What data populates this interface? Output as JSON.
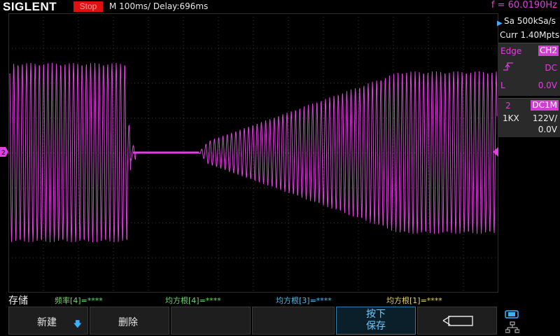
{
  "header": {
    "logo": "SIGLENT",
    "status": "Stop",
    "timebase": "M 100ms/  Delay:696ms",
    "frequency": "f = 60.0190Hz"
  },
  "acquisition": {
    "sample_rate": "Sa 500kSa/s",
    "memory_depth": "Curr 1.40Mpts"
  },
  "trigger": {
    "type": "Edge",
    "source": "CH2",
    "coupling": "DC",
    "level_label": "L",
    "level": "0.0V"
  },
  "channel": {
    "number": "2",
    "coupling": "DC1M",
    "probe": "1KX",
    "scale": "122V/",
    "offset": "0.0V"
  },
  "measurements": {
    "menu_title": "存储",
    "items": [
      {
        "label": "频率[4]=****",
        "color": "#6fd66f"
      },
      {
        "label": "均方根[4]=****",
        "color": "#6fd66f"
      },
      {
        "label": "均方根[3]=****",
        "color": "#55b8e8"
      },
      {
        "label": "均方根[1]=****",
        "color": "#e6d36a"
      }
    ]
  },
  "softkeys": {
    "new": "新建",
    "delete": "删除",
    "press_line1": "按下",
    "press_line2": "保存"
  },
  "colors": {
    "ch2": "#e040e0",
    "grid": "#3a3a3a",
    "selected_border": "#2a7fa8"
  }
}
